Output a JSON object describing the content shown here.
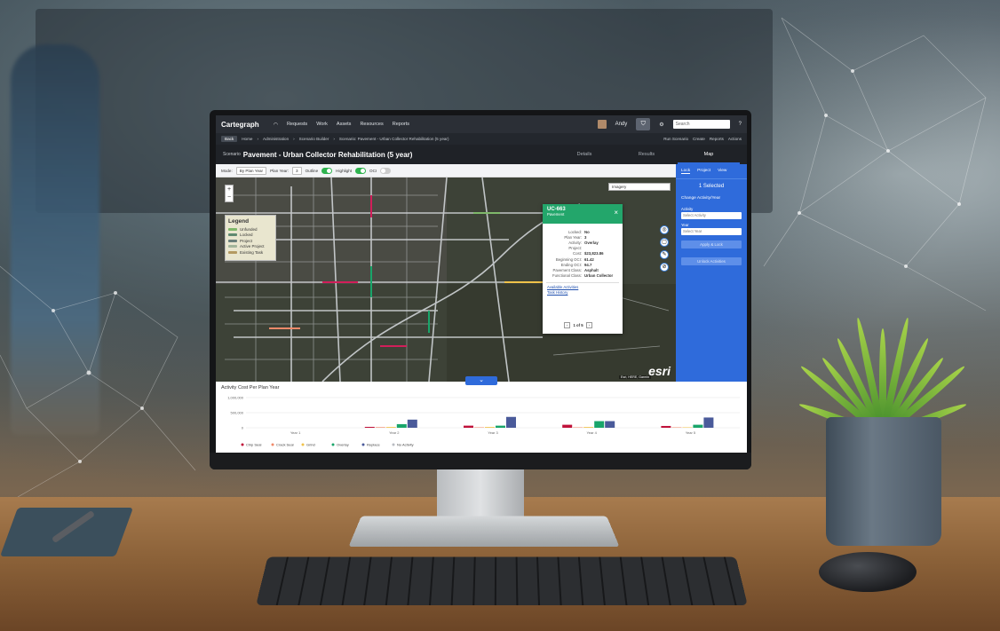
{
  "app": {
    "logo": "Cartegraph",
    "nav": [
      "Requests",
      "Work",
      "Assets",
      "Resources",
      "Reports"
    ],
    "user": "Andy",
    "search_placeholder": "Search"
  },
  "breadcrumb": {
    "back": "Back",
    "items": [
      "Home",
      "Administration",
      "Scenario Builder",
      "Scenario: Pavement - Urban Collector Rehabilitation (5 year)"
    ],
    "actions": [
      "Run Scenario",
      "Create",
      "Reports",
      "Actions"
    ]
  },
  "title": {
    "label": "Scenario",
    "text": "Pavement - Urban Collector Rehabilitation (5 year)",
    "tabs": [
      "Details",
      "Results",
      "Map"
    ],
    "active_tab": "Map"
  },
  "toolbar": {
    "mode_label": "Mode:",
    "mode_value": "By Plan Year",
    "plan_year_label": "Plan Year:",
    "plan_year_value": "3",
    "outline": "Outline",
    "highlight": "Highlight",
    "oci": "OCI"
  },
  "map": {
    "basemap": "Imagery",
    "legend": {
      "title": "Legend",
      "items": [
        {
          "label": "Unfunded",
          "color": "#7fb86a"
        },
        {
          "label": "Locked",
          "color": "#5f8a70"
        },
        {
          "label": "Project",
          "color": "#6a7f7a"
        },
        {
          "label": "Active Project",
          "color": "#a2b59a"
        },
        {
          "label": "Existing Task",
          "color": "#b49a62"
        }
      ]
    },
    "attribution": "Esri, HERE, Garmin",
    "esri": "esri"
  },
  "popup": {
    "id": "UC-663",
    "subtitle": "Pavement",
    "fields": [
      [
        "Locked:",
        "No"
      ],
      [
        "Plan Year:",
        "3"
      ],
      [
        "Activity:",
        "Overlay"
      ],
      [
        "Project:",
        ""
      ],
      [
        "Cost:",
        "$23,823.86"
      ],
      [
        "Beginning OCI:",
        "61.42"
      ],
      [
        "Ending OCI:",
        "94.7"
      ],
      [
        "Pavement Class:",
        "Asphalt"
      ],
      [
        "Functional Class:",
        "Urban Collector"
      ]
    ],
    "links": [
      "Available Activities",
      "Task History"
    ],
    "pager": "1 of 5"
  },
  "side": {
    "tabs": [
      "Lock",
      "Project",
      "View"
    ],
    "selected": "1 Selected",
    "section": "Change Activity/Year",
    "activity_label": "Activity",
    "activity_ph": "Select Activity",
    "year_label": "Year",
    "year_ph": "Select Year",
    "apply": "Apply & Lock",
    "unlock": "Unlock Activities"
  },
  "chart_data": {
    "type": "bar",
    "title": "Activity Cost Per Plan Year",
    "categories": [
      "Year 1",
      "Year 2",
      "Year 3",
      "Year 4",
      "Year 5"
    ],
    "ytick_labels": [
      "1,000,000",
      "500,000",
      "0"
    ],
    "ylim": [
      0,
      1000000
    ],
    "series": [
      {
        "name": "Chip Seal",
        "color": "#c0123a",
        "values": [
          0,
          30000,
          70000,
          100000,
          60000
        ]
      },
      {
        "name": "Crack Seal",
        "color": "#f08a6a",
        "values": [
          0,
          20000,
          15000,
          15000,
          15000
        ]
      },
      {
        "name": "Grind",
        "color": "#f0c24a",
        "values": [
          0,
          25000,
          25000,
          25000,
          15000
        ]
      },
      {
        "name": "Overlay",
        "color": "#19a56a",
        "values": [
          0,
          120000,
          70000,
          220000,
          100000
        ]
      },
      {
        "name": "Replace",
        "color": "#4a5a9a",
        "values": [
          0,
          270000,
          360000,
          220000,
          340000
        ]
      },
      {
        "name": "No Activity",
        "color": "#b9bcc2",
        "values": [
          0,
          0,
          0,
          0,
          0
        ]
      }
    ]
  }
}
